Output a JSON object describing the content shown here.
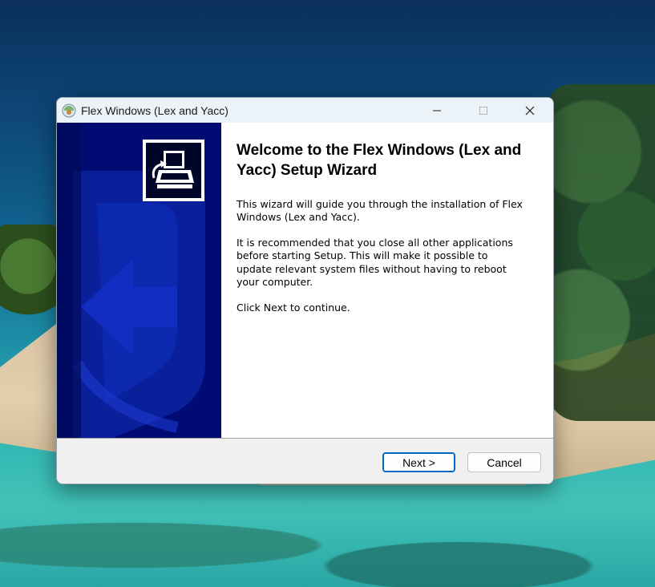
{
  "window": {
    "title": "Flex Windows (Lex and Yacc)"
  },
  "wizard": {
    "heading": "Welcome to the Flex Windows (Lex and Yacc) Setup Wizard",
    "paragraphs": [
      "This wizard will guide you through the installation of Flex Windows (Lex and Yacc).",
      "It is recommended that you close all other applications before starting Setup. This will make it possible to update relevant system files without having to reboot your computer.",
      "Click Next to continue."
    ]
  },
  "buttons": {
    "next": "Next >",
    "cancel": "Cancel"
  },
  "icons": {
    "app": "installer-globe-icon",
    "minimize": "minimize-icon",
    "maximize": "maximize-icon",
    "close": "close-icon",
    "banner": "computer-install-icon"
  },
  "colors": {
    "sidebar": "#000c74",
    "accent": "#0067c0"
  }
}
